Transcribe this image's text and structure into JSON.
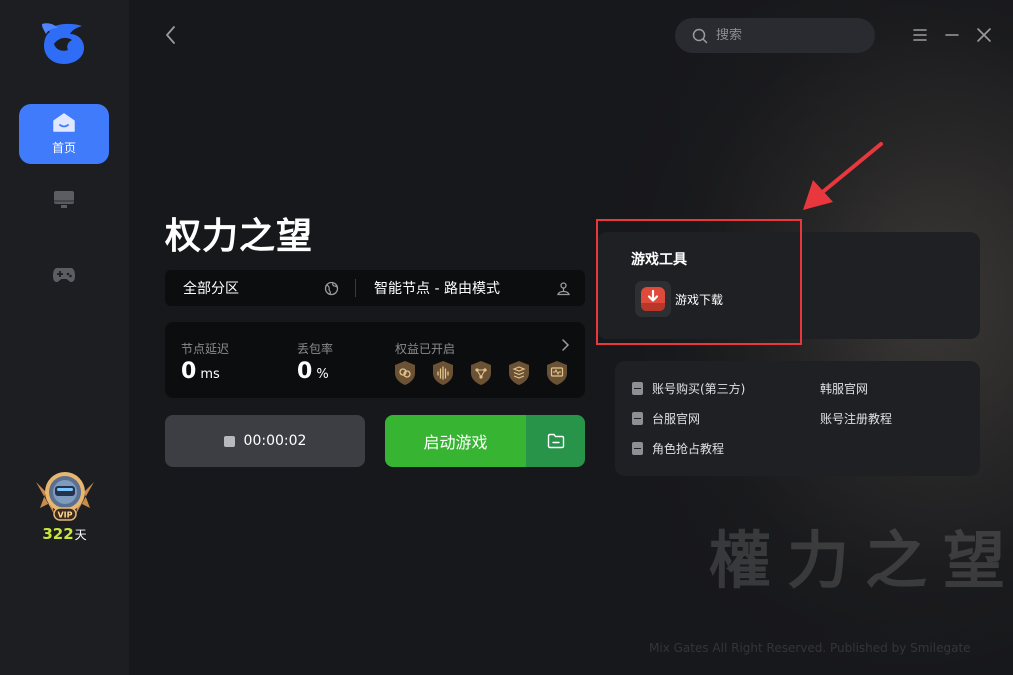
{
  "sidebar": {
    "nav": [
      {
        "label": "首页",
        "icon": "home-icon"
      },
      {
        "label": "",
        "icon": "monitor-icon"
      },
      {
        "label": "",
        "icon": "gamepad-icon"
      }
    ],
    "vip": {
      "badge_text": "VIP",
      "days": "322",
      "unit": "天"
    }
  },
  "header": {
    "search_placeholder": "搜索"
  },
  "game": {
    "title": "权力之望",
    "region": "全部分区",
    "node": "智能节点 - 路由模式"
  },
  "stats": {
    "latency_label": "节点延迟",
    "latency_value": "0",
    "latency_unit": "ms",
    "loss_label": "丢包率",
    "loss_value": "0",
    "loss_unit": "%",
    "perks_label": "权益已开启"
  },
  "actions": {
    "timer": "00:00:02",
    "start_label": "启动游戏"
  },
  "tools": {
    "title": "游戏工具",
    "item_label": "游戏下载"
  },
  "links": [
    "账号购买(第三方)",
    "韩服官网",
    "台服官网",
    "账号注册教程",
    "角色抢占教程"
  ],
  "background": {
    "title_art": "權力之望",
    "copyright": "Mix Gates All Right Reserved. Published by Smilegate"
  },
  "colors": {
    "accent_blue": "#3f7bfb",
    "start_green": "#37b532",
    "vip_green": "#c8e63c",
    "annotation_red": "#e8383d"
  }
}
